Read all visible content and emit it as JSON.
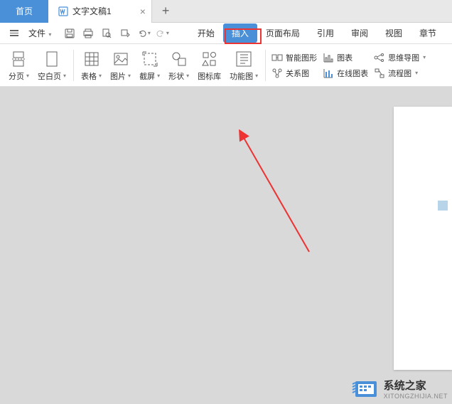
{
  "tabs": {
    "home": "首页",
    "doc": "文字文稿1",
    "close": "×",
    "new": "+"
  },
  "menu": {
    "file": "文件",
    "tabs": [
      "开始",
      "插入",
      "页面布局",
      "引用",
      "审阅",
      "视图",
      "章节"
    ]
  },
  "ribbon": {
    "groups": [
      {
        "label": "分页",
        "dd": true
      },
      {
        "label": "空白页",
        "dd": true
      },
      {
        "label": "表格",
        "dd": true
      },
      {
        "label": "图片",
        "dd": true
      },
      {
        "label": "截屏",
        "dd": true
      },
      {
        "label": "形状",
        "dd": true
      },
      {
        "label": "图标库"
      },
      {
        "label": "功能图",
        "dd": true
      }
    ],
    "side_items": [
      {
        "label": "智能图形"
      },
      {
        "label": "关系图"
      },
      {
        "label": "图表"
      },
      {
        "label": "在线图表"
      },
      {
        "label": "思维导图",
        "dd": true
      },
      {
        "label": "流程图",
        "dd": true
      }
    ]
  },
  "watermark": {
    "title": "系统之家",
    "sub": "XITONGZHIJIA.NET"
  }
}
